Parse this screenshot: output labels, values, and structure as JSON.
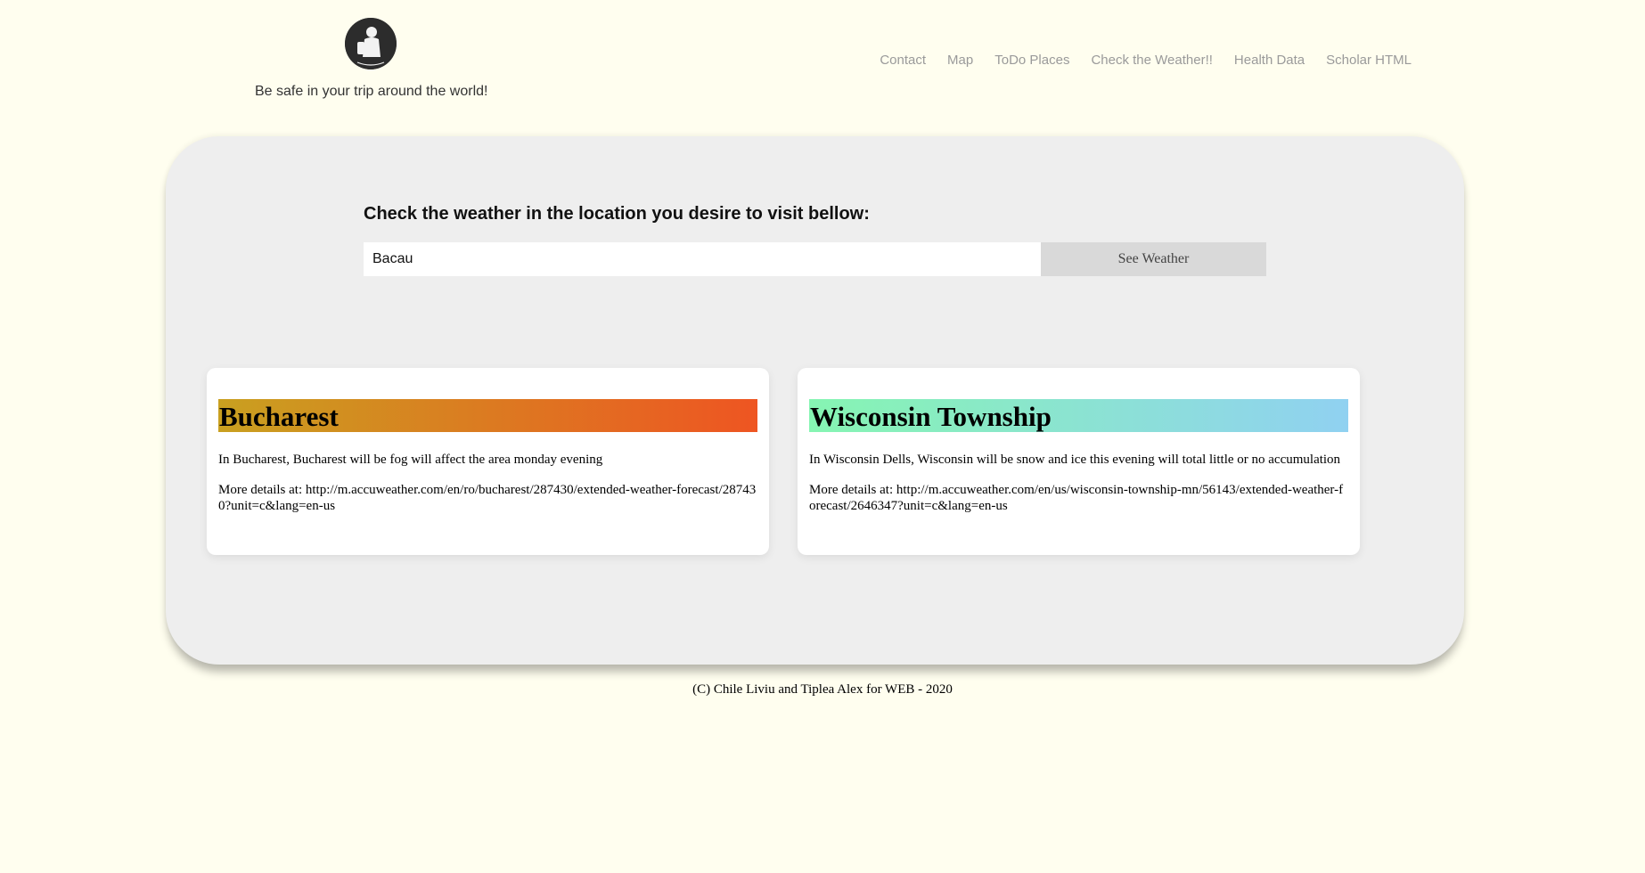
{
  "header": {
    "tagline": "Be safe in your trip around the world!",
    "nav": [
      "Contact",
      "Map",
      "ToDo Places",
      "Check the Weather!!",
      "Health Data",
      "Scholar HTML"
    ]
  },
  "search": {
    "heading": "Check the weather in the location you desire to visit bellow:",
    "input_value": "Bacau",
    "button_label": "See Weather"
  },
  "cards": [
    {
      "city": "Bucharest",
      "summary": "In Bucharest, Bucharest will be fog will affect the area monday evening",
      "details": "More details at: http://m.accuweather.com/en/ro/bucharest/287430/extended-weather-forecast/287430?unit=c&lang=en-us"
    },
    {
      "city": "Wisconsin Township",
      "summary": "In Wisconsin Dells, Wisconsin will be snow and ice this evening will total little or no accumulation",
      "details": "More details at: http://m.accuweather.com/en/us/wisconsin-township-mn/56143/extended-weather-forecast/2646347?unit=c&lang=en-us"
    }
  ],
  "footer": "(C) Chile Liviu and Tiplea Alex for WEB - 2020",
  "colors": {
    "background": "#fffeef",
    "panel": "#eeeeee",
    "card1_gradient": [
      "#c9a020",
      "#ee5522"
    ],
    "card2_gradient": [
      "#86f5b2",
      "#90d1f1"
    ]
  }
}
